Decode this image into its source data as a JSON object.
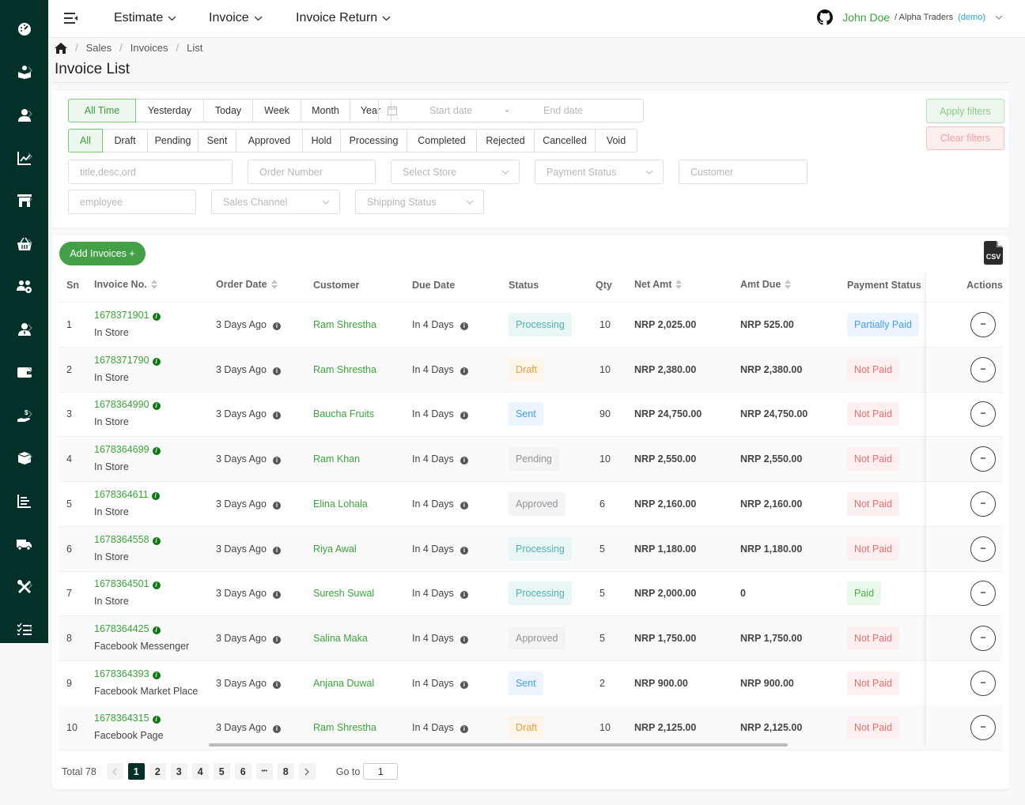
{
  "sidebar": {
    "items": [
      {
        "icon": "dashboard-icon"
      },
      {
        "icon": "catalog-icon"
      },
      {
        "icon": "customer-icon"
      },
      {
        "icon": "analytics-icon"
      },
      {
        "icon": "store-icon"
      },
      {
        "icon": "basket-icon"
      },
      {
        "icon": "users-settings-icon"
      },
      {
        "icon": "employee-icon"
      },
      {
        "icon": "wallet-icon"
      },
      {
        "icon": "payment-icon"
      },
      {
        "icon": "box-icon"
      },
      {
        "icon": "reports-icon"
      },
      {
        "icon": "delivery-truck-icon"
      },
      {
        "icon": "tools-icon"
      },
      {
        "icon": "tasks-icon"
      }
    ]
  },
  "topbar": {
    "nav": [
      "Estimate",
      "Invoice",
      "Invoice Return"
    ],
    "user_name": "John Doe",
    "user_org": "/ Alpha Traders",
    "user_demo": "(demo)"
  },
  "breadcrumb": [
    "Sales",
    "Invoices",
    "List"
  ],
  "page_title": "Invoice List",
  "filters": {
    "time_ranges": [
      "All Time",
      "Yesterday",
      "Today",
      "Week",
      "Month",
      "Year"
    ],
    "time_active": "All Time",
    "start_date_placeholder": "Start date",
    "end_date_placeholder": "End date",
    "date_separator": "-",
    "statuses": [
      "All",
      "Draft",
      "Pending",
      "Sent",
      "Approved",
      "Hold",
      "Processing",
      "Completed",
      "Rejected",
      "Cancelled",
      "Void"
    ],
    "status_active": "All",
    "apply_label": "Apply filters",
    "clear_label": "Clear filters",
    "search_placeholder": "title,desc,ord",
    "order_number_placeholder": "Order Number",
    "store_placeholder": "Select Store",
    "payment_status_placeholder": "Payment Status",
    "customer_placeholder": "Customer",
    "employee_placeholder": "employee",
    "sales_channel_placeholder": "Sales Channel",
    "shipping_status_placeholder": "Shipping Status"
  },
  "table": {
    "add_label": "Add Invoices +",
    "csv_label": "CSV",
    "columns": [
      "Sn",
      "Invoice No.",
      "Order Date",
      "Customer",
      "Due Date",
      "Status",
      "Qty",
      "Net Amt",
      "Amt Due",
      "Payment Status",
      "Actions"
    ],
    "rows": [
      {
        "sn": "1",
        "invoice_no": "1678371901",
        "channel": "In Store",
        "order_date": "3 Days Ago",
        "customer": "Ram Shrestha",
        "due_date": "In 4 Days",
        "status": "Processing",
        "qty": "10",
        "net_amt": "NRP 2,025.00",
        "amt_due": "NRP 525.00",
        "payment_status": "Partially Paid"
      },
      {
        "sn": "2",
        "invoice_no": "1678371790",
        "channel": "In Store",
        "order_date": "3 Days Ago",
        "customer": "Ram Shrestha",
        "due_date": "In 4 Days",
        "status": "Draft",
        "qty": "10",
        "net_amt": "NRP 2,380.00",
        "amt_due": "NRP 2,380.00",
        "payment_status": "Not Paid"
      },
      {
        "sn": "3",
        "invoice_no": "1678364990",
        "channel": "In Store",
        "order_date": "3 Days Ago",
        "customer": "Baucha Fruits",
        "due_date": "In 4 Days",
        "status": "Sent",
        "qty": "90",
        "net_amt": "NRP 24,750.00",
        "amt_due": "NRP 24,750.00",
        "payment_status": "Not Paid"
      },
      {
        "sn": "4",
        "invoice_no": "1678364699",
        "channel": "In Store",
        "order_date": "3 Days Ago",
        "customer": "Ram Khan",
        "due_date": "In 4 Days",
        "status": "Pending",
        "qty": "10",
        "net_amt": "NRP 2,550.00",
        "amt_due": "NRP 2,550.00",
        "payment_status": "Not Paid"
      },
      {
        "sn": "5",
        "invoice_no": "1678364611",
        "channel": "In Store",
        "order_date": "3 Days Ago",
        "customer": "Elina Lohala",
        "due_date": "In 4 Days",
        "status": "Approved",
        "qty": "6",
        "net_amt": "NRP 2,160.00",
        "amt_due": "NRP 2,160.00",
        "payment_status": "Not Paid"
      },
      {
        "sn": "6",
        "invoice_no": "1678364558",
        "channel": "In Store",
        "order_date": "3 Days Ago",
        "customer": "Riya Awal",
        "due_date": "In 4 Days",
        "status": "Processing",
        "qty": "5",
        "net_amt": "NRP 1,180.00",
        "amt_due": "NRP 1,180.00",
        "payment_status": "Not Paid"
      },
      {
        "sn": "7",
        "invoice_no": "1678364501",
        "channel": "In Store",
        "order_date": "3 Days Ago",
        "customer": "Suresh Suwal",
        "due_date": "In 4 Days",
        "status": "Processing",
        "qty": "5",
        "net_amt": "NRP 2,000.00",
        "amt_due": "0",
        "payment_status": "Paid"
      },
      {
        "sn": "8",
        "invoice_no": "1678364425",
        "channel": "Facebook Messenger",
        "order_date": "3 Days Ago",
        "customer": "Salina Maka",
        "due_date": "In 4 Days",
        "status": "Approved",
        "qty": "5",
        "net_amt": "NRP 1,750.00",
        "amt_due": "NRP 1,750.00",
        "payment_status": "Not Paid"
      },
      {
        "sn": "9",
        "invoice_no": "1678364393",
        "channel": "Facebook Market Place",
        "order_date": "3 Days Ago",
        "customer": "Anjana Duwal",
        "due_date": "In 4 Days",
        "status": "Sent",
        "qty": "2",
        "net_amt": "NRP 900.00",
        "amt_due": "NRP 900.00",
        "payment_status": "Not Paid"
      },
      {
        "sn": "10",
        "invoice_no": "1678364315",
        "channel": "Facebook Page",
        "order_date": "3 Days Ago",
        "customer": "Ram Shrestha",
        "due_date": "In 4 Days",
        "status": "Draft",
        "qty": "10",
        "net_amt": "NRP 2,125.00",
        "amt_due": "NRP 2,125.00",
        "payment_status": "Not Paid"
      }
    ]
  },
  "status_colors": {
    "Processing": {
      "bg": "#eaf6f6",
      "fg": "#4db3ab"
    },
    "Draft": {
      "bg": "#fdf5ea",
      "fg": "#e6a23c"
    },
    "Sent": {
      "bg": "#ecf5ff",
      "fg": "#409eff"
    },
    "Pending": {
      "bg": "#f4f4f5",
      "fg": "#909399"
    },
    "Approved": {
      "bg": "#f4f4f5",
      "fg": "#909399"
    },
    "Partially Paid": {
      "bg": "#ecf5ff",
      "fg": "#409eff"
    },
    "Not Paid": {
      "bg": "#fef0f0",
      "fg": "#f56c6c"
    },
    "Paid": {
      "bg": "#eaf8ea",
      "fg": "#4caf50"
    }
  },
  "pagination": {
    "total_label": "Total 78",
    "pages": [
      "1",
      "2",
      "3",
      "4",
      "5",
      "6",
      "•••",
      "8"
    ],
    "current": "1",
    "goto_label": "Go to",
    "goto_value": "1"
  }
}
